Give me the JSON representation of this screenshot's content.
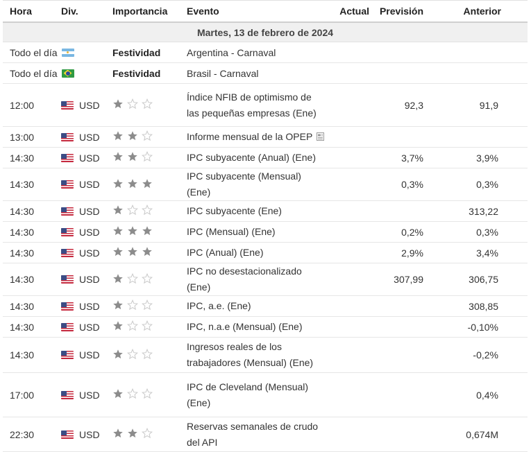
{
  "header": {
    "time": "Hora",
    "currency": "Div.",
    "importance": "Importancia",
    "event": "Evento",
    "actual": "Actual",
    "forecast": "Previsión",
    "previous": "Anterior"
  },
  "date_label": "Martes, 13 de febrero de 2024",
  "colors": {
    "star_filled": "#8c8c8c",
    "star_empty": "#c9c9c9",
    "date_bg": "#f0f0f0"
  },
  "holidays": [
    {
      "time": "Todo el día",
      "flag": "argentina-flag-icon",
      "importance": "Festividad",
      "event": "Argentina - Carnaval"
    },
    {
      "time": "Todo el día",
      "flag": "brazil-flag-icon",
      "importance": "Festividad",
      "event": "Brasil - Carnaval"
    }
  ],
  "events": [
    {
      "time": "12:00",
      "currency": "USD",
      "stars": 1,
      "event": "Índice NFIB de optimismo de las pequeñas empresas (Ene)",
      "actual": "",
      "forecast": "92,3",
      "previous": "91,9"
    },
    {
      "time": "13:00",
      "currency": "USD",
      "stars": 2,
      "event": "Informe mensual de la OPEP",
      "doc_icon": "document-icon",
      "actual": "",
      "forecast": "",
      "previous": ""
    },
    {
      "time": "14:30",
      "currency": "USD",
      "stars": 2,
      "event": "IPC subyacente (Anual) (Ene)",
      "actual": "",
      "forecast": "3,7%",
      "previous": "3,9%"
    },
    {
      "time": "14:30",
      "currency": "USD",
      "stars": 3,
      "event": "IPC subyacente (Mensual) (Ene)",
      "actual": "",
      "forecast": "0,3%",
      "previous": "0,3%"
    },
    {
      "time": "14:30",
      "currency": "USD",
      "stars": 1,
      "event": "IPC subyacente (Ene)",
      "actual": "",
      "forecast": "",
      "previous": "313,22"
    },
    {
      "time": "14:30",
      "currency": "USD",
      "stars": 3,
      "event": "IPC (Mensual) (Ene)",
      "actual": "",
      "forecast": "0,2%",
      "previous": "0,3%"
    },
    {
      "time": "14:30",
      "currency": "USD",
      "stars": 3,
      "event": "IPC (Anual) (Ene)",
      "actual": "",
      "forecast": "2,9%",
      "previous": "3,4%"
    },
    {
      "time": "14:30",
      "currency": "USD",
      "stars": 1,
      "event": "IPC no desestacionalizado (Ene)",
      "actual": "",
      "forecast": "307,99",
      "previous": "306,75"
    },
    {
      "time": "14:30",
      "currency": "USD",
      "stars": 1,
      "event": "IPC, a.e. (Ene)",
      "actual": "",
      "forecast": "",
      "previous": "308,85"
    },
    {
      "time": "14:30",
      "currency": "USD",
      "stars": 1,
      "event": "IPC, n.a.e (Mensual) (Ene)",
      "actual": "",
      "forecast": "",
      "previous": "-0,10%"
    },
    {
      "time": "14:30",
      "currency": "USD",
      "stars": 1,
      "event": "Ingresos reales de los trabajadores (Mensual) (Ene)",
      "actual": "",
      "forecast": "",
      "previous": "-0,2%"
    },
    {
      "time": "17:00",
      "currency": "USD",
      "stars": 1,
      "event": "IPC de Cleveland (Mensual) (Ene)",
      "actual": "",
      "forecast": "",
      "previous": "0,4%"
    },
    {
      "time": "22:30",
      "currency": "USD",
      "stars": 2,
      "event": "Reservas semanales de crudo del API",
      "actual": "",
      "forecast": "",
      "previous": "0,674M"
    }
  ]
}
